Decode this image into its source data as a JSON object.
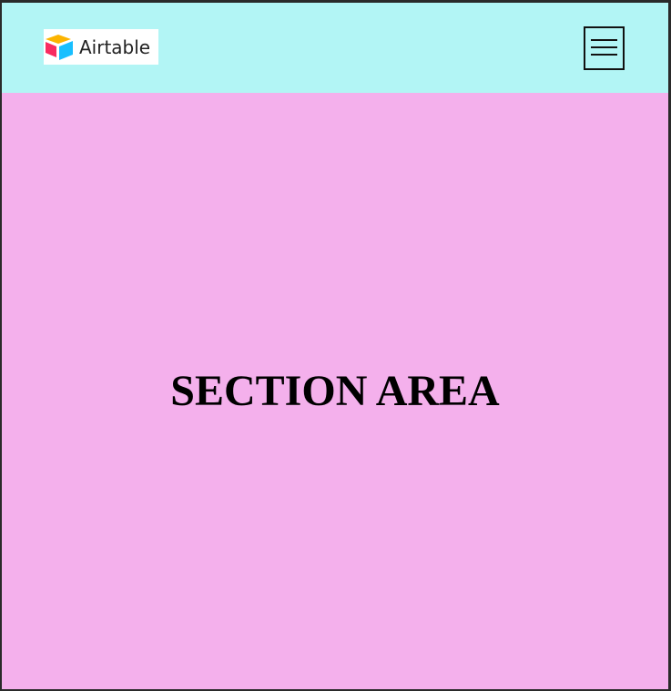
{
  "header": {
    "logo": {
      "text": "Airtable",
      "icon": "airtable-logo-icon",
      "colors": {
        "top": "#fcb400",
        "left": "#f82b60",
        "right": "#18bfff"
      }
    },
    "menu_icon": "hamburger-menu-icon",
    "background": "#b2f5f5"
  },
  "section": {
    "title": "SECTION AREA",
    "background": "#f4b0ec"
  }
}
